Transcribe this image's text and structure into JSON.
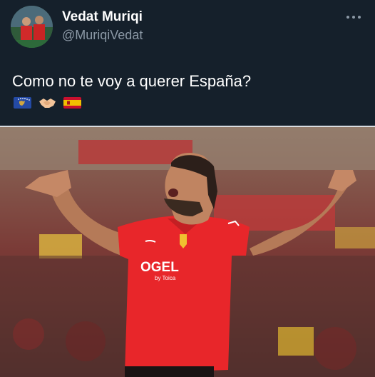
{
  "tweet": {
    "author_name": "Vedat Muriqi",
    "author_handle": "@MuriqiVedat",
    "text": "Como no te voy a querer España?",
    "emojis": [
      "kosovo-flag-icon",
      "handshake-icon",
      "spain-flag-icon"
    ]
  },
  "media": {
    "jersey_sponsor": "OGEL",
    "jersey_sponsor_sub": "by Toica"
  },
  "colors": {
    "background": "#15202b",
    "handle": "#8b98a5",
    "jersey": "#e8262a"
  }
}
